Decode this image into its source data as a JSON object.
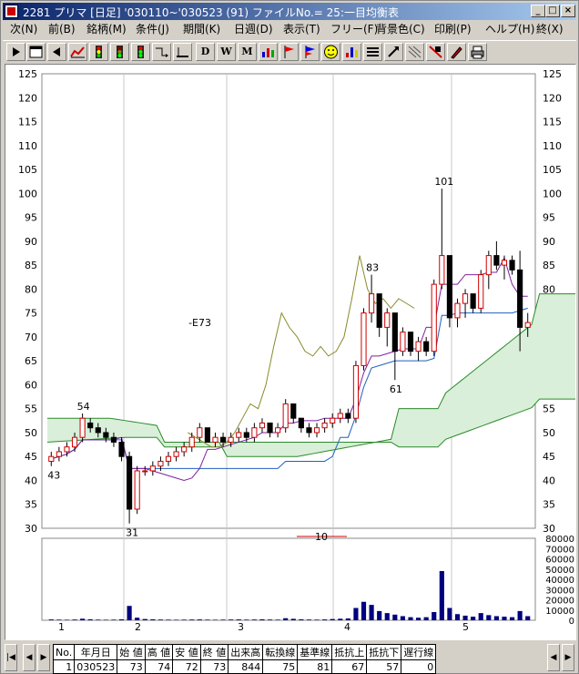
{
  "window": {
    "title": "2281 プリマ [日足] '030110~'030523 (91) ファイルNo.= 25:一目均衡表",
    "buttons": [
      "_",
      "□",
      "×"
    ]
  },
  "menu": [
    {
      "label": "次(N)"
    },
    {
      "label": "前(B)"
    },
    {
      "label": "銘柄(M)"
    },
    {
      "label": "条件(J)"
    },
    {
      "label": "期間(K)"
    },
    {
      "label": "日週(D)"
    },
    {
      "label": "表示(T)"
    },
    {
      "label": "フリー(F)"
    },
    {
      "label": "背景色(C)"
    },
    {
      "label": "印刷(P)"
    },
    {
      "label": "ヘルプ(H)"
    },
    {
      "label": "終(X)"
    }
  ],
  "toolbar": {
    "letters": {
      "d": "D",
      "w": "W",
      "m": "M"
    },
    "icons": [
      "play-icon",
      "window-icon",
      "back-icon",
      "chart-icon",
      "signal-red-icon",
      "signal-green-icon",
      "signal-yellow-icon",
      "arrow-split-icon",
      "line-icon",
      "d-icon",
      "w-icon",
      "m-icon",
      "bar-chart-icon",
      "red-flag-icon",
      "blue-flag-icon",
      "smiley-icon",
      "bars-icon",
      "list-icon",
      "arrow-icon",
      "pattern-icon",
      "eraser-icon",
      "pen-icon",
      "print-icon"
    ]
  },
  "chart": {
    "y_ticks": [
      "125",
      "120",
      "115",
      "110",
      "105",
      "100",
      "95",
      "90",
      "85",
      "80",
      "75",
      "70",
      "65",
      "60",
      "55",
      "50",
      "45",
      "40",
      "35",
      "30"
    ],
    "volume_ticks": [
      "80000",
      "70000",
      "60000",
      "50000",
      "40000",
      "30000",
      "20000",
      "10000",
      "0"
    ],
    "x_labels": [
      "1",
      "2",
      "3",
      "4",
      "5"
    ],
    "annotations": {
      "high_54": "54",
      "low_43": "43",
      "low_31": "31",
      "e73": "-E73",
      "p83": "83",
      "p61": "61",
      "high_101": "101",
      "range_10": "10"
    }
  },
  "chart_data": {
    "type": "candlestick",
    "title": "",
    "ylim": [
      30,
      125
    ],
    "volume_ylim": [
      0,
      80000
    ],
    "x_months": [
      "1",
      "2",
      "3",
      "4",
      "5"
    ],
    "ohlc": [
      [
        44,
        46,
        43,
        45
      ],
      [
        45,
        47,
        44,
        46
      ],
      [
        46,
        48,
        45,
        47
      ],
      [
        47,
        50,
        46,
        49
      ],
      [
        49,
        54,
        48,
        53
      ],
      [
        52,
        53,
        50,
        51
      ],
      [
        51,
        52,
        49,
        50
      ],
      [
        50,
        51,
        48,
        49
      ],
      [
        49,
        50,
        47,
        48
      ],
      [
        48,
        49,
        44,
        45
      ],
      [
        45,
        46,
        31,
        34
      ],
      [
        34,
        43,
        33,
        42
      ],
      [
        42,
        43,
        41,
        42
      ],
      [
        42,
        44,
        41,
        43
      ],
      [
        43,
        45,
        42,
        44
      ],
      [
        44,
        46,
        43,
        45
      ],
      [
        45,
        47,
        44,
        46
      ],
      [
        46,
        48,
        45,
        47
      ],
      [
        47,
        50,
        46,
        49
      ],
      [
        49,
        52,
        48,
        51
      ],
      [
        51,
        50,
        48,
        48
      ],
      [
        48,
        50,
        47,
        49
      ],
      [
        49,
        50,
        47,
        48
      ],
      [
        48,
        50,
        47,
        49
      ],
      [
        49,
        51,
        48,
        50
      ],
      [
        50,
        51,
        48,
        49
      ],
      [
        49,
        52,
        48,
        51
      ],
      [
        51,
        53,
        50,
        52
      ],
      [
        52,
        51,
        49,
        50
      ],
      [
        50,
        52,
        49,
        51
      ],
      [
        51,
        57,
        50,
        56
      ],
      [
        56,
        55,
        52,
        53
      ],
      [
        53,
        53,
        50,
        51
      ],
      [
        51,
        52,
        49,
        50
      ],
      [
        50,
        52,
        49,
        51
      ],
      [
        51,
        53,
        50,
        52
      ],
      [
        52,
        54,
        51,
        53
      ],
      [
        53,
        55,
        52,
        54
      ],
      [
        54,
        55,
        52,
        53
      ],
      [
        53,
        65,
        52,
        64
      ],
      [
        64,
        76,
        63,
        75
      ],
      [
        75,
        83,
        73,
        79
      ],
      [
        79,
        76,
        70,
        72
      ],
      [
        72,
        76,
        68,
        75
      ],
      [
        75,
        75,
        61,
        67
      ],
      [
        67,
        72,
        66,
        71
      ],
      [
        71,
        71,
        66,
        67
      ],
      [
        67,
        70,
        65,
        69
      ],
      [
        69,
        70,
        66,
        67
      ],
      [
        67,
        82,
        66,
        81
      ],
      [
        81,
        101,
        80,
        87
      ],
      [
        87,
        82,
        72,
        74
      ],
      [
        74,
        78,
        72,
        77
      ],
      [
        77,
        80,
        74,
        79
      ],
      [
        79,
        79,
        75,
        76
      ],
      [
        76,
        84,
        75,
        83
      ],
      [
        83,
        88,
        80,
        87
      ],
      [
        87,
        90,
        84,
        85
      ],
      [
        85,
        87,
        82,
        86
      ],
      [
        86,
        87,
        83,
        84
      ],
      [
        84,
        88,
        67,
        72
      ],
      [
        72,
        75,
        70,
        73
      ]
    ],
    "volume": [
      800,
      600,
      500,
      700,
      1500,
      900,
      600,
      500,
      600,
      900,
      14000,
      2500,
      1200,
      900,
      700,
      600,
      500,
      600,
      700,
      800,
      600,
      500,
      600,
      700,
      800,
      600,
      700,
      900,
      700,
      600,
      2000,
      1400,
      900,
      700,
      600,
      800,
      1200,
      1500,
      1800,
      12000,
      18000,
      15000,
      9000,
      7000,
      5500,
      4000,
      3000,
      2500,
      3000,
      8000,
      48000,
      12000,
      6000,
      4500,
      3500,
      7000,
      5000,
      4000,
      3500,
      3000,
      9000,
      4000
    ]
  }
}
